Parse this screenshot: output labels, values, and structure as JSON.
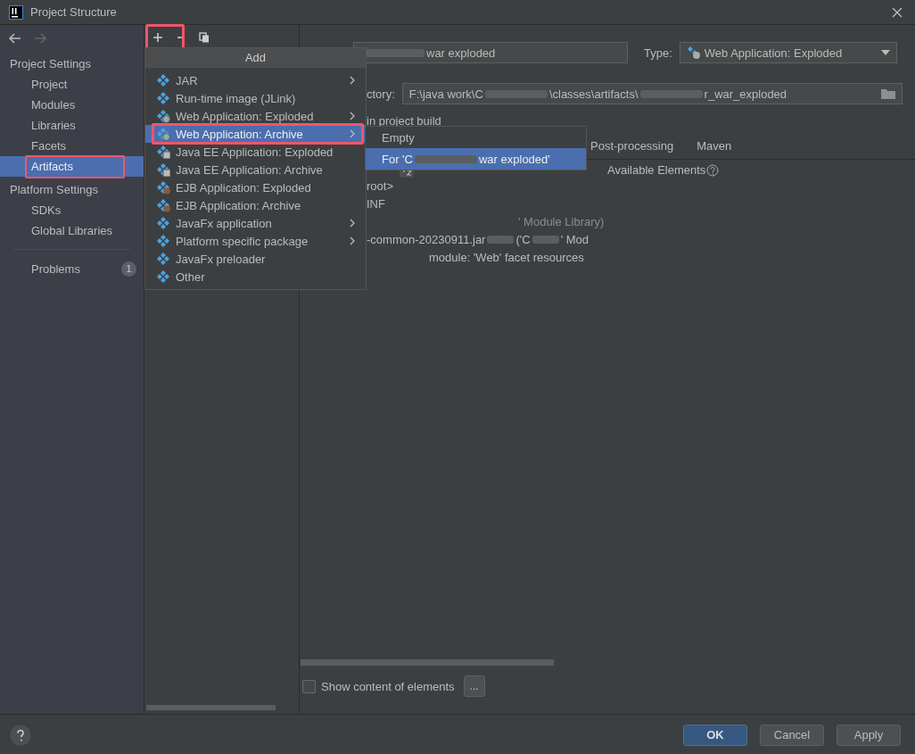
{
  "window": {
    "title": "Project Structure"
  },
  "sidebar": {
    "groups": [
      {
        "title": "Project Settings",
        "items": [
          {
            "label": "Project",
            "selected": false,
            "highlighted": false
          },
          {
            "label": "Modules",
            "selected": false,
            "highlighted": false
          },
          {
            "label": "Libraries",
            "selected": false,
            "highlighted": false
          },
          {
            "label": "Facets",
            "selected": false,
            "highlighted": false
          },
          {
            "label": "Artifacts",
            "selected": true,
            "highlighted": true
          }
        ]
      },
      {
        "title": "Platform Settings",
        "items": [
          {
            "label": "SDKs",
            "selected": false,
            "highlighted": false
          },
          {
            "label": "Global Libraries",
            "selected": false,
            "highlighted": false
          }
        ]
      }
    ],
    "problems": {
      "label": "Problems",
      "count": "1"
    }
  },
  "toolbar": {
    "add_highlighted": true
  },
  "add_menu": {
    "title": "Add",
    "items": [
      {
        "label": "JAR",
        "kind": "plain",
        "submenu": true,
        "selected": false,
        "highlighted": false
      },
      {
        "label": "Run-time image (JLink)",
        "kind": "plain",
        "submenu": false,
        "selected": false,
        "highlighted": false
      },
      {
        "label": "Web Application: Exploded",
        "kind": "web",
        "submenu": true,
        "selected": false,
        "highlighted": false
      },
      {
        "label": "Web Application: Archive",
        "kind": "web",
        "submenu": true,
        "selected": true,
        "highlighted": true
      },
      {
        "label": "Java EE Application: Exploded",
        "kind": "javaee",
        "submenu": false,
        "selected": false,
        "highlighted": false
      },
      {
        "label": "Java EE Application: Archive",
        "kind": "javaee",
        "submenu": false,
        "selected": false,
        "highlighted": false
      },
      {
        "label": "EJB Application: Exploded",
        "kind": "ejb",
        "submenu": false,
        "selected": false,
        "highlighted": false
      },
      {
        "label": "EJB Application: Archive",
        "kind": "ejb",
        "submenu": false,
        "selected": false,
        "highlighted": false
      },
      {
        "label": "JavaFx application",
        "kind": "plain",
        "submenu": true,
        "selected": false,
        "highlighted": false
      },
      {
        "label": "Platform specific package",
        "kind": "plain",
        "submenu": true,
        "selected": false,
        "highlighted": false
      },
      {
        "label": "JavaFx preloader",
        "kind": "plain",
        "submenu": false,
        "selected": false,
        "highlighted": false
      },
      {
        "label": "Other",
        "kind": "plain",
        "submenu": false,
        "selected": false,
        "highlighted": false
      }
    ]
  },
  "submenu": {
    "items": [
      {
        "parts": [
          "Empty"
        ],
        "selected": false
      },
      {
        "parts": [
          "For 'C",
          "war exploded'"
        ],
        "selected": true
      }
    ]
  },
  "artifact": {
    "name_parts": [
      "war exploded"
    ],
    "type_label": "Type:",
    "type_value": "Web Application: Exploded",
    "output_label": "ctory:",
    "output_parts": [
      "F:\\java work\\C",
      "\\classes\\artifacts\\",
      "r_war_exploded"
    ],
    "build_label": "in project build",
    "tabs": [
      {
        "label": "Post-processing",
        "selected": false
      },
      {
        "label": "Maven",
        "selected": false
      }
    ],
    "tree": [
      {
        "parts": [
          "root>"
        ]
      },
      {
        "parts": [
          "INF"
        ]
      },
      {
        "parts": [
          "' Module Library)"
        ],
        "dim": true
      },
      {
        "parts": [
          "-common-20230911.jar",
          "('C",
          "' Mod"
        ],
        "dim": false
      },
      {
        "parts": [
          "module: 'Web' facet resources"
        ],
        "dim": false
      }
    ],
    "available_label": "Available Elements",
    "show_content": {
      "label": "Show content of elements",
      "checked": false
    },
    "more_button": "..."
  },
  "buttons": [
    {
      "label": "OK",
      "primary": true
    },
    {
      "label": "Cancel",
      "primary": false
    },
    {
      "label": "Apply",
      "primary": false
    }
  ]
}
